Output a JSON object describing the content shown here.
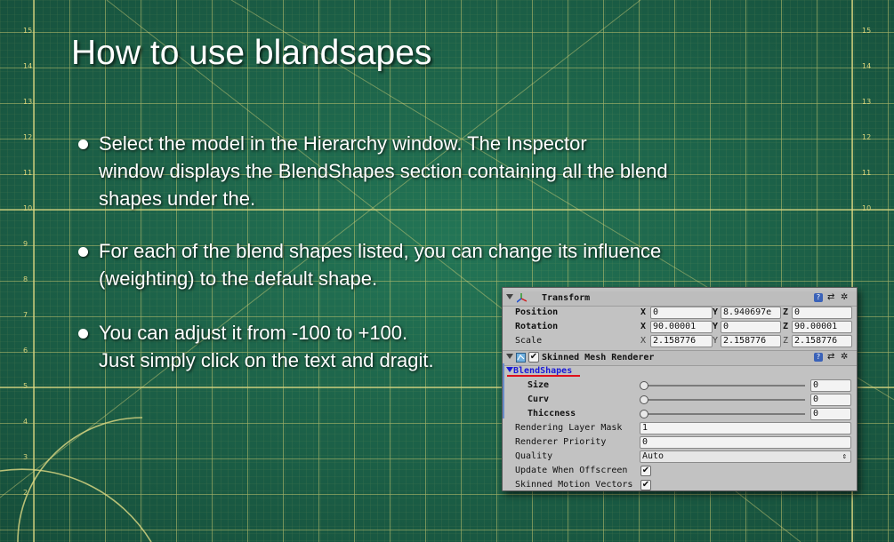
{
  "slide": {
    "title": "How to use blandsapes",
    "bullets": [
      {
        "lines": [
          "Select the model in the Hierarchy window. The Inspector",
          "window displays the BlendShapes section containing all the blend",
          "shapes under the."
        ]
      },
      {
        "lines": [
          "For each of the blend shapes listed, you can change its influence",
          "(weighting) to the default shape."
        ]
      },
      {
        "lines": [
          "You can adjust it from -100 to +100.",
          "Just simply click on the text and dragit."
        ]
      }
    ]
  },
  "colors": {
    "mat_background": "#1d6a4f",
    "grid_line": "#c9c56a",
    "title_text": "#ffffff",
    "blendshapes_link": "#1b1bd6",
    "highlight_underline": "#e0101a"
  },
  "ruler": {
    "left_numbers": [
      "15",
      "14",
      "13",
      "12",
      "11",
      "10",
      "9",
      "8",
      "7",
      "6",
      "5",
      "4",
      "3",
      "2"
    ],
    "right_numbers": [
      "15",
      "14",
      "13",
      "12",
      "11",
      "10"
    ]
  },
  "inspector": {
    "transform": {
      "title": "Transform",
      "position": {
        "label": "Position",
        "x": "0",
        "y": "8.940697e",
        "z": "0"
      },
      "rotation": {
        "label": "Rotation",
        "x": "90.00001",
        "y": "0",
        "z": "90.00001"
      },
      "scale": {
        "label": "Scale",
        "x": "2.158776",
        "y": "2.158776",
        "z": "2.158776"
      },
      "axes": {
        "x": "X",
        "y": "Y",
        "z": "Z"
      }
    },
    "skinned_mesh_renderer": {
      "title": "Skinned Mesh Renderer",
      "enabled": true,
      "blendshapes_label": "BlendShapes",
      "blendshapes": [
        {
          "label": "Size",
          "value": "0",
          "weight": 0
        },
        {
          "label": "Curv",
          "value": "0",
          "weight": 0
        },
        {
          "label": "Thiccness",
          "value": "0",
          "weight": 0
        }
      ],
      "rendering_layer_mask": {
        "label": "Rendering Layer Mask",
        "value": "1"
      },
      "renderer_priority": {
        "label": "Renderer Priority",
        "value": "0"
      },
      "quality": {
        "label": "Quality",
        "value": "Auto"
      },
      "update_when_offscreen": {
        "label": "Update When Offscreen",
        "checked": true
      },
      "skinned_motion_vectors": {
        "label": "Skinned Motion Vectors",
        "checked": true
      }
    },
    "icons": [
      "help-icon",
      "settings-sliders-icon",
      "gear-icon"
    ]
  }
}
